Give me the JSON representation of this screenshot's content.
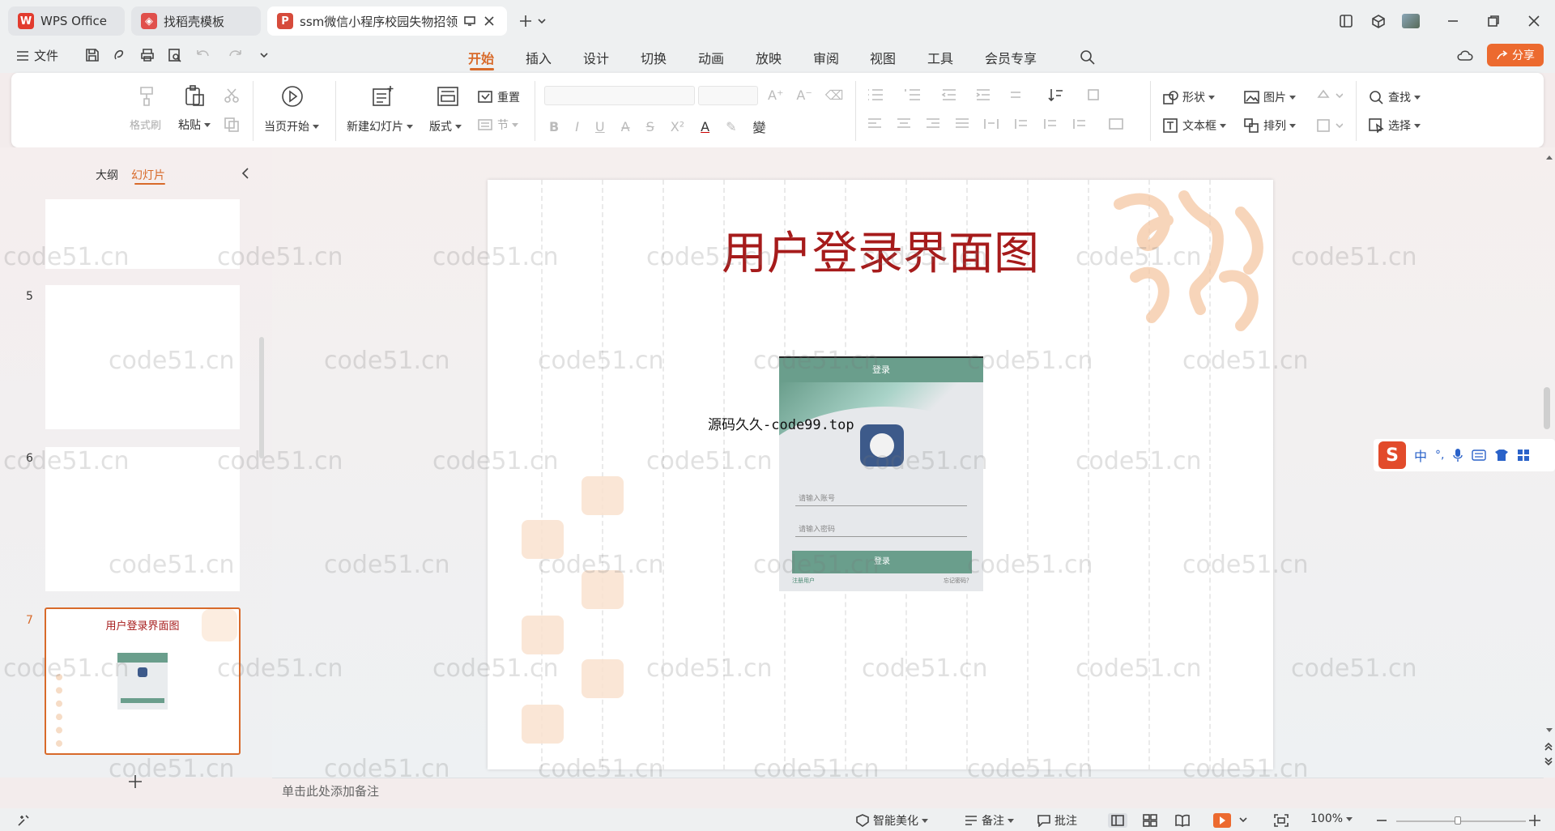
{
  "tabs": [
    {
      "label": "WPS Office"
    },
    {
      "label": "找稻壳模板"
    },
    {
      "label": "ssm微信小程序校园失物招领"
    }
  ],
  "menu": {
    "file": "文件",
    "items": [
      "开始",
      "插入",
      "设计",
      "切换",
      "动画",
      "放映",
      "审阅",
      "视图",
      "工具",
      "会员专享"
    ],
    "share": "分享"
  },
  "ribbon": {
    "format_painter": "格式刷",
    "paste": "粘贴",
    "play_from_current": "当页开始",
    "new_slide": "新建幻灯片",
    "layout": "版式",
    "reset": "重置",
    "section": "节",
    "shape": "形状",
    "picture": "图片",
    "textbox": "文本框",
    "arrange": "排列",
    "find": "查找",
    "select": "选择"
  },
  "panel": {
    "outline_tab": "大纲",
    "slides_tab": "幻灯片",
    "slide_numbers": [
      "5",
      "6",
      "7"
    ],
    "thumb7_title": "用户登录界面图"
  },
  "slide": {
    "title": "用户登录界面图",
    "watermark_text": "源码久久-code99.top",
    "phone": {
      "header": "登录",
      "account_placeholder": "请输入账号",
      "password_placeholder": "请输入密码",
      "login_button": "登录",
      "register_link": "注册用户",
      "forgot_link": "忘记密码？"
    }
  },
  "notes_placeholder": "单击此处添加备注",
  "status": {
    "beautify": "智能美化",
    "notes": "备注",
    "comments": "批注",
    "zoom": "100%"
  },
  "ime": {
    "lang": "中",
    "punct": "°,"
  },
  "page_watermark": "code51.cn",
  "colors": {
    "accent": "#d86a2a",
    "title_red": "#a61b1b",
    "phone_green": "#6a9e8c"
  }
}
